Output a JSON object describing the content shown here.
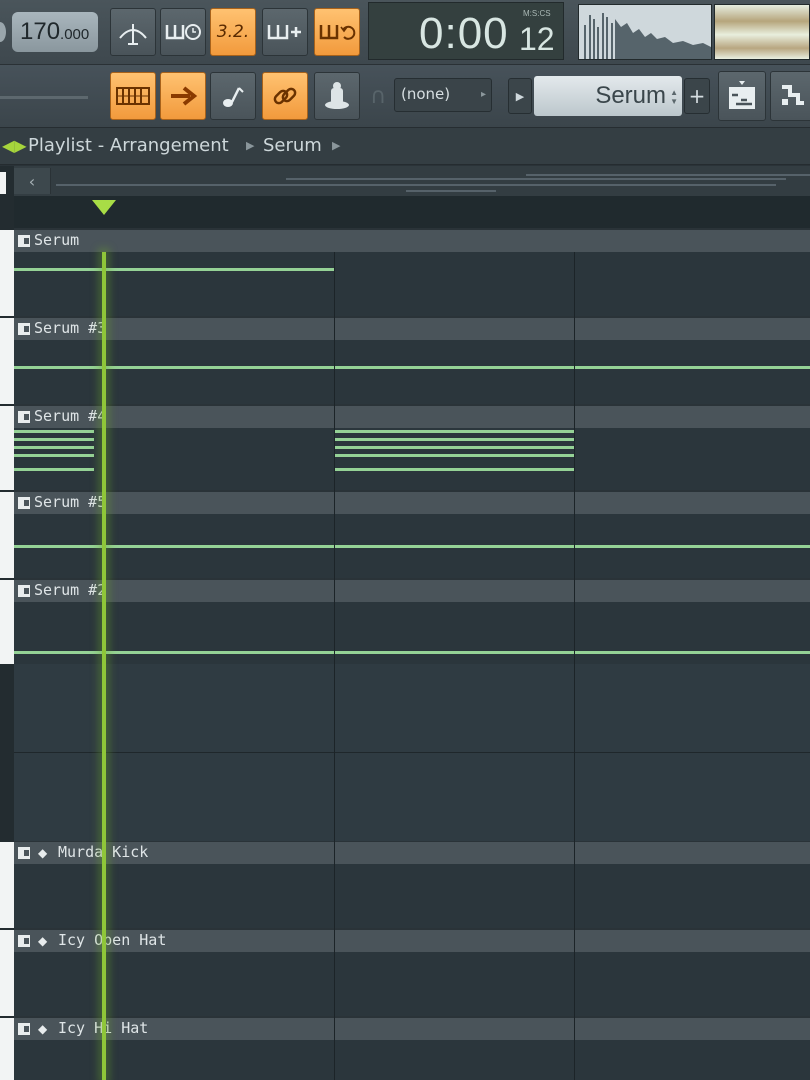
{
  "toolbar": {
    "tempo_whole": "170",
    "tempo_decimal": ".000",
    "buttons_top": [
      {
        "name": "metronome-button",
        "icon": "metronome-icon",
        "on": false
      },
      {
        "name": "wait-input-button",
        "icon": "wait-for-input-icon",
        "on": false
      },
      {
        "name": "countdown-button",
        "icon": "countdown-icon",
        "label": "3.2.",
        "on": true
      },
      {
        "name": "blend-recording-button",
        "icon": "blend-notes-icon",
        "on": false
      },
      {
        "name": "loop-record-button",
        "icon": "loop-record-icon",
        "on": true
      }
    ],
    "buttons_bottom": [
      {
        "name": "step-edit-button",
        "icon": "piano-keys-icon",
        "on": true
      },
      {
        "name": "snap-arrow-button",
        "icon": "arrow-right-icon",
        "on": true
      },
      {
        "name": "typing-keyboard-button",
        "icon": "note-icon",
        "on": false
      },
      {
        "name": "link-button",
        "icon": "link-icon",
        "on": true
      },
      {
        "name": "hint-button",
        "icon": "stamp-icon",
        "on": false
      }
    ],
    "time_main": "0:00",
    "time_ms": "12",
    "time_caption": "M:S:CS",
    "pattern_value": "(none)",
    "channel_value": "Serum",
    "add_label": "+",
    "colors": {
      "active_button": "#f29a3c",
      "playhead": "#8fc639",
      "note": "#95d296"
    }
  },
  "playlist": {
    "title": "Playlist - Arrangement",
    "channel": "Serum"
  },
  "tracks": [
    {
      "label": "Serum"
    },
    {
      "label": "Serum #3"
    },
    {
      "label": "Serum #4"
    },
    {
      "label": "Serum #5"
    },
    {
      "label": "Serum #2"
    },
    {
      "label": "Murda Kick"
    },
    {
      "label": "Icy Open Hat"
    },
    {
      "label": "Icy Hi Hat"
    }
  ]
}
